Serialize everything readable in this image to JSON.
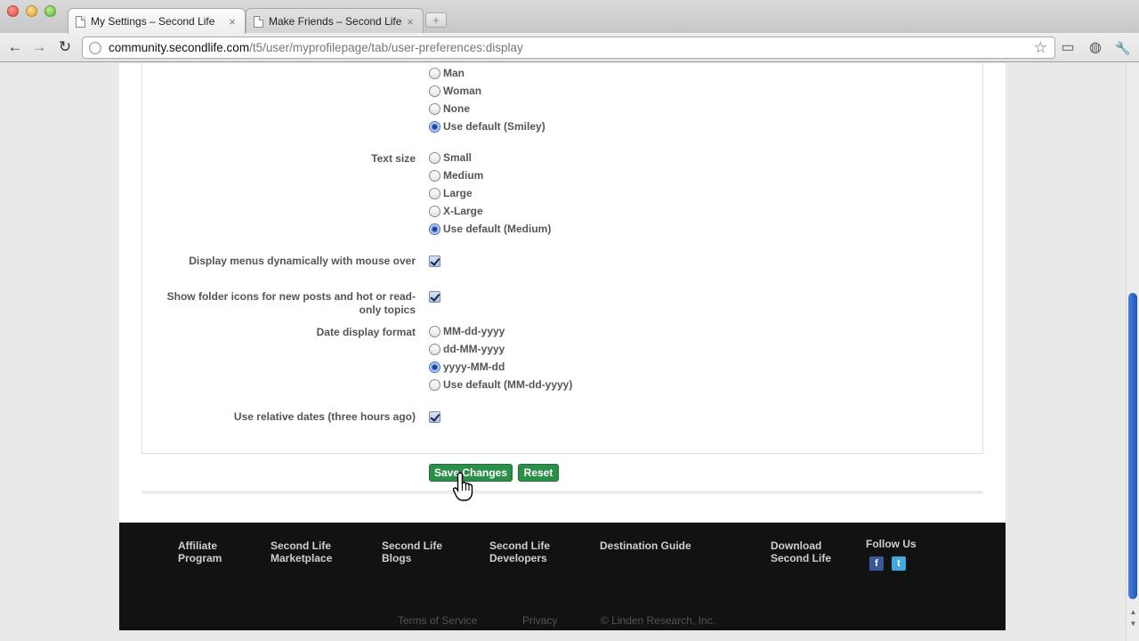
{
  "browser": {
    "tabs": [
      {
        "title": "My Settings – Second Life",
        "close": "×"
      },
      {
        "title": "Make Friends – Second Life",
        "close": "×"
      }
    ],
    "new_tab": "+",
    "url_host": "community.secondlife.com",
    "url_path": "/t5/user/myprofilepage/tab/user-preferences:display",
    "icons": {
      "back": "←",
      "forward": "→",
      "reload": "↻",
      "star": "☆",
      "page": "▭",
      "extension": "◍",
      "wrench": "🔧"
    }
  },
  "settings": {
    "avatar_options": [
      {
        "label": "Man",
        "checked": false
      },
      {
        "label": "Woman",
        "checked": false
      },
      {
        "label": "None",
        "checked": false
      },
      {
        "label": "Use default (Smiley)",
        "checked": true
      }
    ],
    "text_size": {
      "label": "Text size",
      "options": [
        {
          "label": "Small",
          "checked": false
        },
        {
          "label": "Medium",
          "checked": false
        },
        {
          "label": "Large",
          "checked": false
        },
        {
          "label": "X-Large",
          "checked": false
        },
        {
          "label": "Use default (Medium)",
          "checked": true
        }
      ]
    },
    "dynamic_menus": {
      "label": "Display menus dynamically with mouse over",
      "checked": true
    },
    "folder_icons": {
      "label_line1": "Show folder icons for new posts and hot or read-",
      "label_line2": "only topics",
      "checked": true
    },
    "date_format": {
      "label": "Date display format",
      "options": [
        {
          "label": "MM-dd-yyyy",
          "checked": false
        },
        {
          "label": "dd-MM-yyyy",
          "checked": false
        },
        {
          "label": "yyyy-MM-dd",
          "checked": true
        },
        {
          "label": "Use default (MM-dd-yyyy)",
          "checked": false
        }
      ]
    },
    "relative_dates": {
      "label": "Use relative dates (three hours ago)",
      "checked": true
    },
    "save_label": "Save Changes",
    "reset_label": "Reset"
  },
  "footer": {
    "links": [
      {
        "line1": "Affiliate",
        "line2": "Program"
      },
      {
        "line1": "Second Life",
        "line2": "Marketplace"
      },
      {
        "line1": "Second Life",
        "line2": "Blogs"
      },
      {
        "line1": "Second Life",
        "line2": "Developers"
      },
      {
        "line1": "Destination Guide",
        "line2": ""
      },
      {
        "line1": "Download",
        "line2": "Second Life"
      }
    ],
    "follow_us": "Follow Us",
    "facebook": "f",
    "twitter": "t",
    "legal": [
      "Terms of Service",
      "Privacy",
      "© Linden Research, Inc."
    ]
  },
  "colors": {
    "button_green": "#2b8f4a",
    "footer_bg": "#121212",
    "scroll_thumb": "#1f56c0"
  }
}
